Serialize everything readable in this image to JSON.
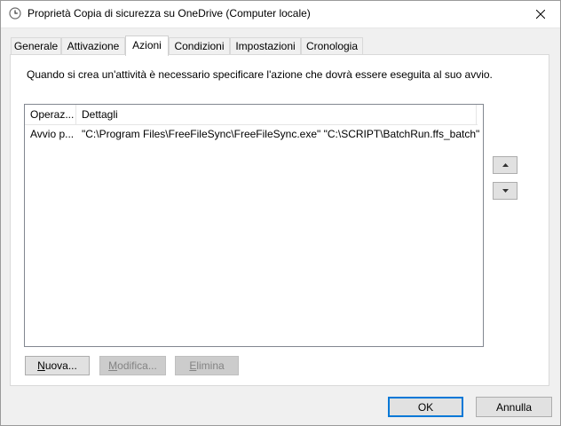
{
  "window": {
    "title": "Proprietà Copia di sicurezza su OneDrive (Computer locale)"
  },
  "tabs": [
    {
      "label": "Generale",
      "active": false
    },
    {
      "label": "Attivazione",
      "active": false
    },
    {
      "label": "Azioni",
      "active": true
    },
    {
      "label": "Condizioni",
      "active": false
    },
    {
      "label": "Impostazioni",
      "active": false
    },
    {
      "label": "Cronologia",
      "active": false
    }
  ],
  "actions_tab": {
    "description": "Quando si crea un'attività è necessario specificare l'azione che dovrà essere eseguita al suo avvio.",
    "columns": [
      "Operaz...",
      "Dettagli"
    ],
    "rows": [
      {
        "action": "Avvio p...",
        "details": "\"C:\\Program Files\\FreeFileSync\\FreeFileSync.exe\" \"C:\\SCRIPT\\BatchRun.ffs_batch\""
      }
    ],
    "buttons": {
      "new": {
        "key": "N",
        "rest": "uova..."
      },
      "edit": {
        "key": "M",
        "rest": "odifica..."
      },
      "delete": {
        "key": "E",
        "rest": "limina"
      }
    }
  },
  "footer": {
    "ok": "OK",
    "cancel": "Annulla"
  },
  "icons": {
    "window": "clock-icon",
    "move_up": "arrow-up-icon",
    "move_down": "arrow-down-icon",
    "close": "close-icon"
  }
}
